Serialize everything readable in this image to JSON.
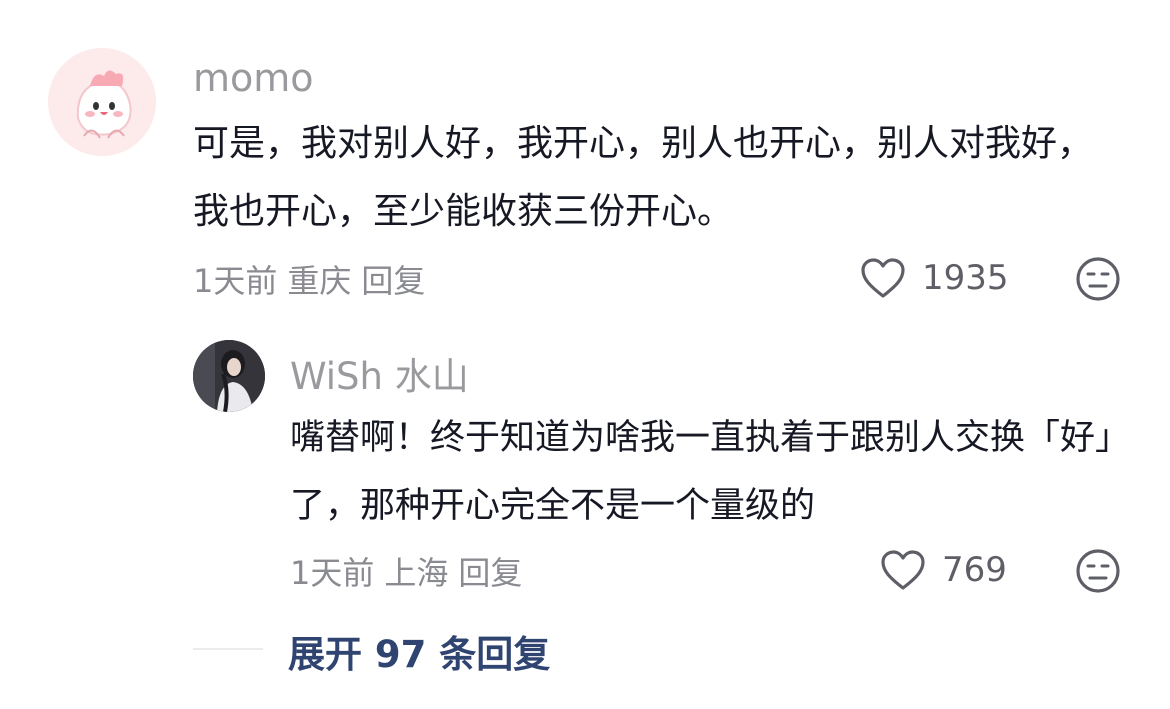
{
  "comments": [
    {
      "username": "momo",
      "content": "可是，我对别人好，我开心，别人也开心，别人对我好，我也开心，至少能收获三份开心。",
      "time": "1天前",
      "location": "重庆",
      "reply_label": "回复",
      "likes": "1935"
    },
    {
      "username": "WiSh 水山",
      "content": "嘴替啊！终于知道为啥我一直执着于跟别人交换「好」了，那种开心完全不是一个量级的",
      "time": "1天前",
      "location": "上海",
      "reply_label": "回复",
      "likes": "769"
    }
  ],
  "expand_label": "展开 97 条回复",
  "colors": {
    "username": "#9a9a9e",
    "text": "#161823",
    "meta": "#8a8b91",
    "expand": "#2f4470"
  },
  "icons": [
    "avatar-momo",
    "avatar-wish",
    "heart-icon",
    "dislike-face-icon"
  ]
}
